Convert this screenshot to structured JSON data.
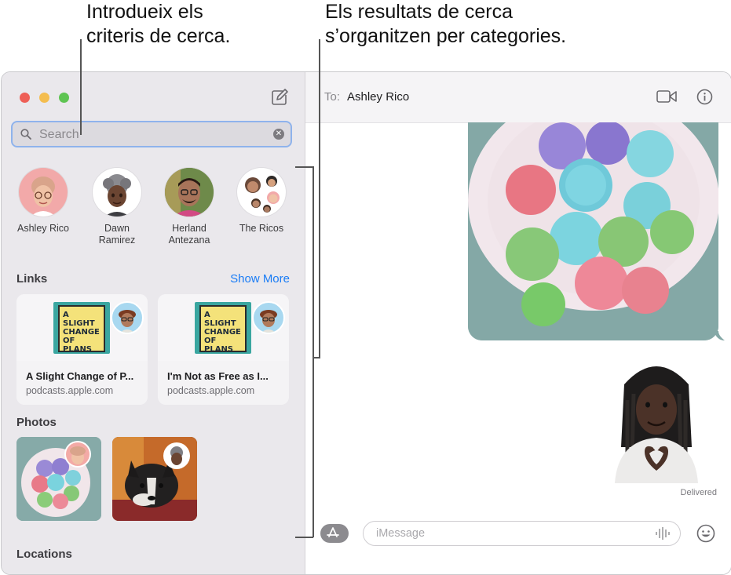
{
  "annotations": {
    "search_callout": "Introdueix els\ncriteris de cerca.",
    "results_callout": "Els resultats de cerca\ns’organitzen per categories."
  },
  "colors": {
    "accent": "#1a7cf5",
    "close": "#ee5f57",
    "minimize": "#f4bd4f",
    "zoom": "#5ec452",
    "search_focus": "#8fb3ec"
  },
  "sidebar": {
    "search": {
      "placeholder": "Search",
      "value": ""
    },
    "contacts": [
      {
        "name": "Ashley Rico"
      },
      {
        "name": "Dawn\nRamirez"
      },
      {
        "name": "Herland\nAntezana"
      },
      {
        "name": "The Ricos"
      }
    ],
    "links": {
      "title": "Links",
      "show_more": "Show More",
      "items": [
        {
          "title": "A Slight Change of P...",
          "domain": "podcasts.apple.com",
          "art_text": "A SLIGHT\nCHANGE OF\nPLANS"
        },
        {
          "title": "I'm Not as Free as I...",
          "domain": "podcasts.apple.com",
          "art_text": "A SLIGHT\nCHANGE OF\nPLANS"
        }
      ]
    },
    "photos": {
      "title": "Photos"
    },
    "locations": {
      "title": "Locations"
    }
  },
  "chat": {
    "to_label": "To:",
    "recipient": "Ashley Rico",
    "status": "Delivered",
    "message_placeholder": "iMessage"
  },
  "icons": {
    "compose": "compose-icon",
    "search": "search-icon",
    "clear": "clear-icon",
    "video": "video-camera-icon",
    "info": "info-icon",
    "apps": "app-store-icon",
    "audio": "waveform-icon",
    "emoji": "emoji-icon"
  }
}
